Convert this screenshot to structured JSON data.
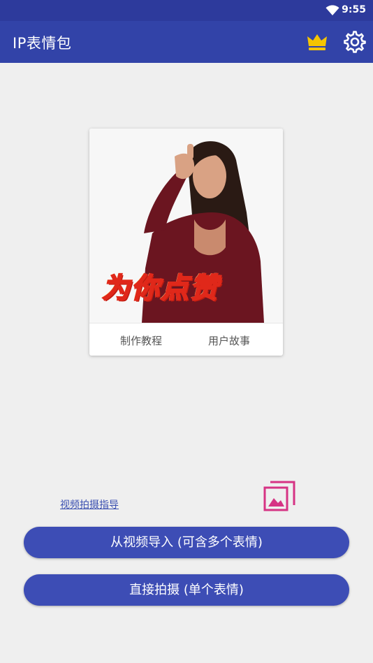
{
  "status_bar": {
    "time": "9:55",
    "wifi_icon": "wifi-icon"
  },
  "app_bar": {
    "title": "IP表情包",
    "crown_icon": "crown-icon",
    "settings_icon": "gear-icon",
    "accent": "#3243a8"
  },
  "sample_card": {
    "caption": "为你点赞",
    "tabs": [
      {
        "label": "制作教程"
      },
      {
        "label": "用户故事"
      }
    ]
  },
  "guide_link": "视频拍摄指导",
  "gallery_icon": "gallery-icon",
  "buttons": {
    "import_from_video": "从视频导入 (可含多个表情)",
    "direct_shoot": "直接拍摄 (单个表情)"
  }
}
